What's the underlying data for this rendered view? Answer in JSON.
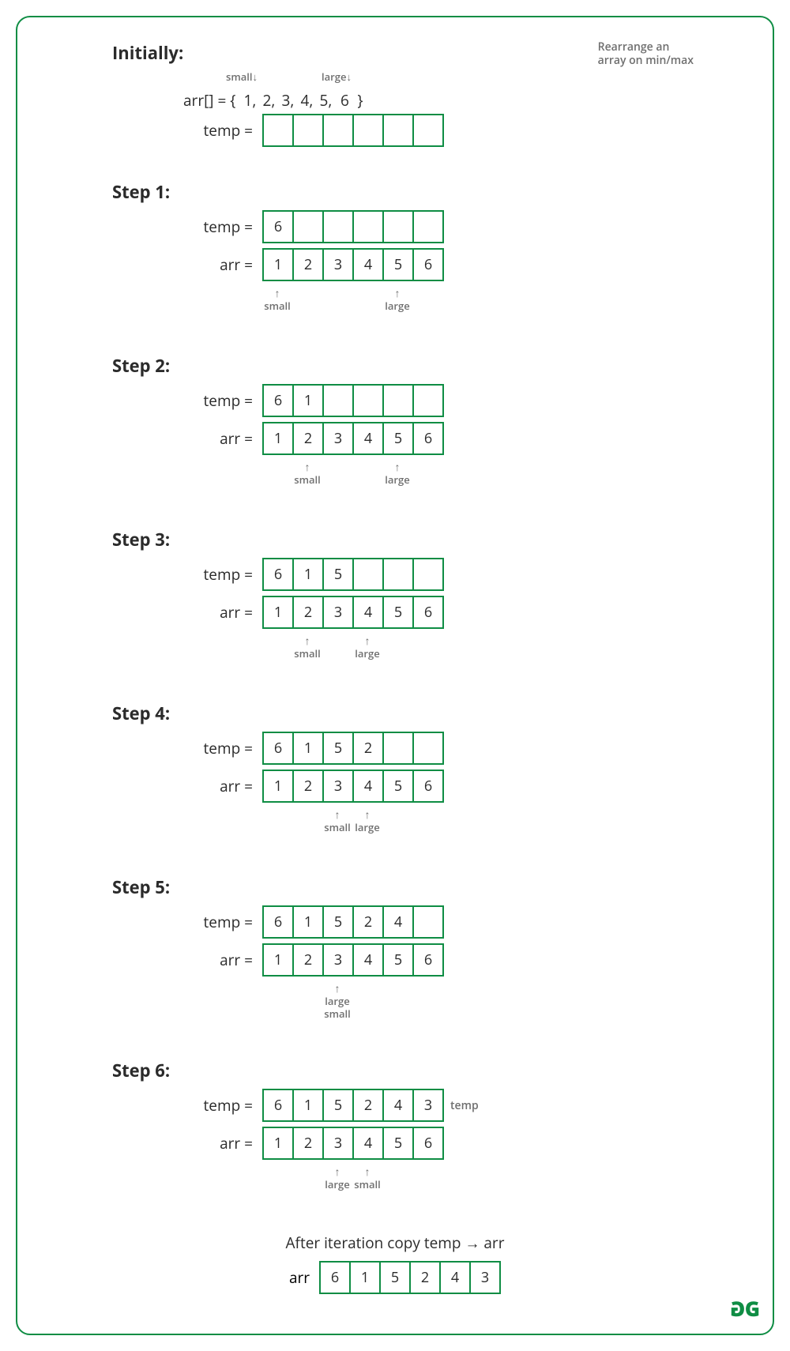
{
  "colors": {
    "accent": "#0f8d44",
    "muted": "#6f6f6f",
    "text": "#2b2b2b"
  },
  "title_note_l1": "Rearrange an",
  "title_note_l2": "array on min/max",
  "logo_text": "GG",
  "arrow_glyph": "→",
  "initial": {
    "heading": "Initially:",
    "arr_prefix": "arr[] = {",
    "arr_suffix": "}",
    "arr_values": [
      "1",
      "2",
      "3",
      "4",
      "5",
      "6"
    ],
    "temp_label": "temp =",
    "temp": [
      "",
      "",
      "",
      "",
      "",
      ""
    ],
    "pointers_above": [
      {
        "label": "small",
        "cell": 0
      },
      {
        "label": "large",
        "cell": 5
      }
    ]
  },
  "steps": [
    {
      "heading": "Step 1:",
      "temp_label": "temp =",
      "arr_label": "arr =",
      "temp": [
        "6",
        "",
        "",
        "",
        "",
        ""
      ],
      "arr": [
        "1",
        "2",
        "3",
        "4",
        "5",
        "6"
      ],
      "pointers_below": [
        {
          "label": "small",
          "cell": 0
        },
        {
          "label": "large",
          "cell": 4
        }
      ]
    },
    {
      "heading": "Step 2:",
      "temp_label": "temp =",
      "arr_label": "arr =",
      "temp": [
        "6",
        "1",
        "",
        "",
        "",
        ""
      ],
      "arr": [
        "1",
        "2",
        "3",
        "4",
        "5",
        "6"
      ],
      "pointers_below": [
        {
          "label": "small",
          "cell": 1
        },
        {
          "label": "large",
          "cell": 4
        }
      ]
    },
    {
      "heading": "Step 3:",
      "temp_label": "temp =",
      "arr_label": "arr =",
      "temp": [
        "6",
        "1",
        "5",
        "",
        "",
        ""
      ],
      "arr": [
        "1",
        "2",
        "3",
        "4",
        "5",
        "6"
      ],
      "pointers_below": [
        {
          "label": "small",
          "cell": 1
        },
        {
          "label": "large",
          "cell": 3
        }
      ]
    },
    {
      "heading": "Step 4:",
      "temp_label": "temp =",
      "arr_label": "arr =",
      "temp": [
        "6",
        "1",
        "5",
        "2",
        "",
        ""
      ],
      "arr": [
        "1",
        "2",
        "3",
        "4",
        "5",
        "6"
      ],
      "pointers_below": [
        {
          "label": "small",
          "cell": 2
        },
        {
          "label": "large",
          "cell": 3
        }
      ]
    },
    {
      "heading": "Step 5:",
      "temp_label": "temp =",
      "arr_label": "arr =",
      "temp": [
        "6",
        "1",
        "5",
        "2",
        "4",
        ""
      ],
      "arr": [
        "1",
        "2",
        "3",
        "4",
        "5",
        "6"
      ],
      "pointers_stacked": {
        "cell": 2,
        "labels": [
          "large",
          "small"
        ]
      }
    },
    {
      "heading": "Step 6:",
      "temp_label": "temp =",
      "arr_label": "arr =",
      "temp": [
        "6",
        "1",
        "5",
        "2",
        "4",
        "3"
      ],
      "temp_after": "temp",
      "arr": [
        "1",
        "2",
        "3",
        "4",
        "5",
        "6"
      ],
      "pointers_below": [
        {
          "label": "large",
          "cell": 2
        },
        {
          "label": "small",
          "cell": 3
        }
      ]
    }
  ],
  "final": {
    "note_prefix": "After iteration copy temp ",
    "note_suffix": " arr",
    "arr_label": "arr",
    "arr": [
      "6",
      "1",
      "5",
      "2",
      "4",
      "3"
    ]
  }
}
